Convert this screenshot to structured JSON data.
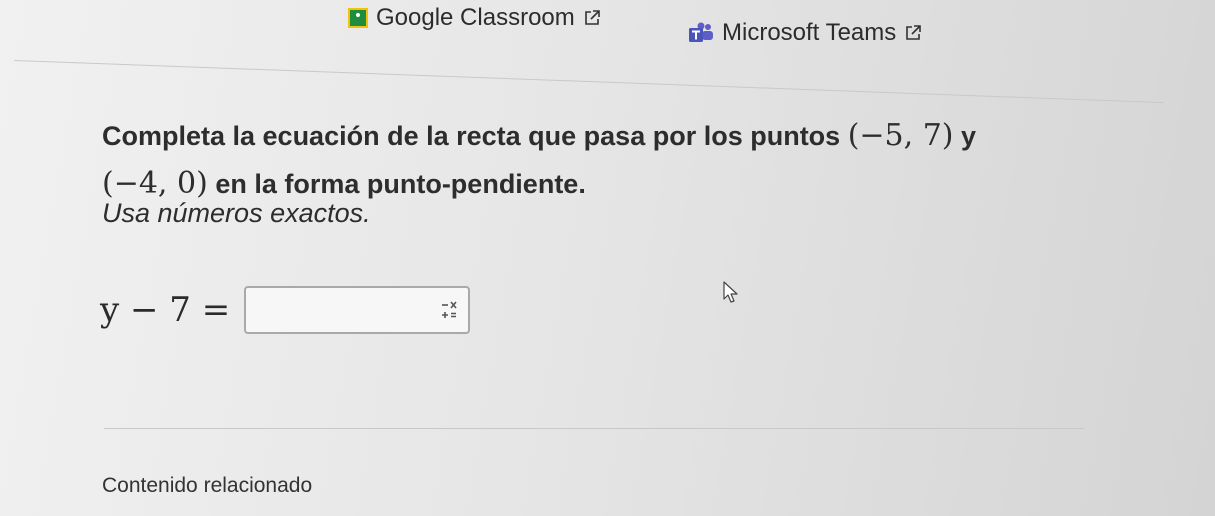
{
  "header": {
    "links": [
      {
        "label": "Google Classroom",
        "icon": "google-classroom-icon",
        "external": true
      },
      {
        "label": "Microsoft Teams",
        "icon": "microsoft-teams-icon",
        "external": true
      }
    ]
  },
  "question": {
    "text_before": "Completa la ecuación de la recta que pasa por los puntos",
    "point1": "(−5, 7)",
    "connector": "y",
    "point2": "(−4, 0)",
    "text_after": "en la forma punto-pendiente.",
    "instruction": "Usa números exactos."
  },
  "equation": {
    "lhs": "y − 7 =",
    "answer_value": "",
    "keypad_icon": "math-keypad-icon"
  },
  "footer": {
    "related_label": "Contenido relacionado"
  },
  "colors": {
    "classroom_green": "#1e8e3e",
    "classroom_yellow": "#f4c20d",
    "teams_purple": "#5b5fc7"
  }
}
